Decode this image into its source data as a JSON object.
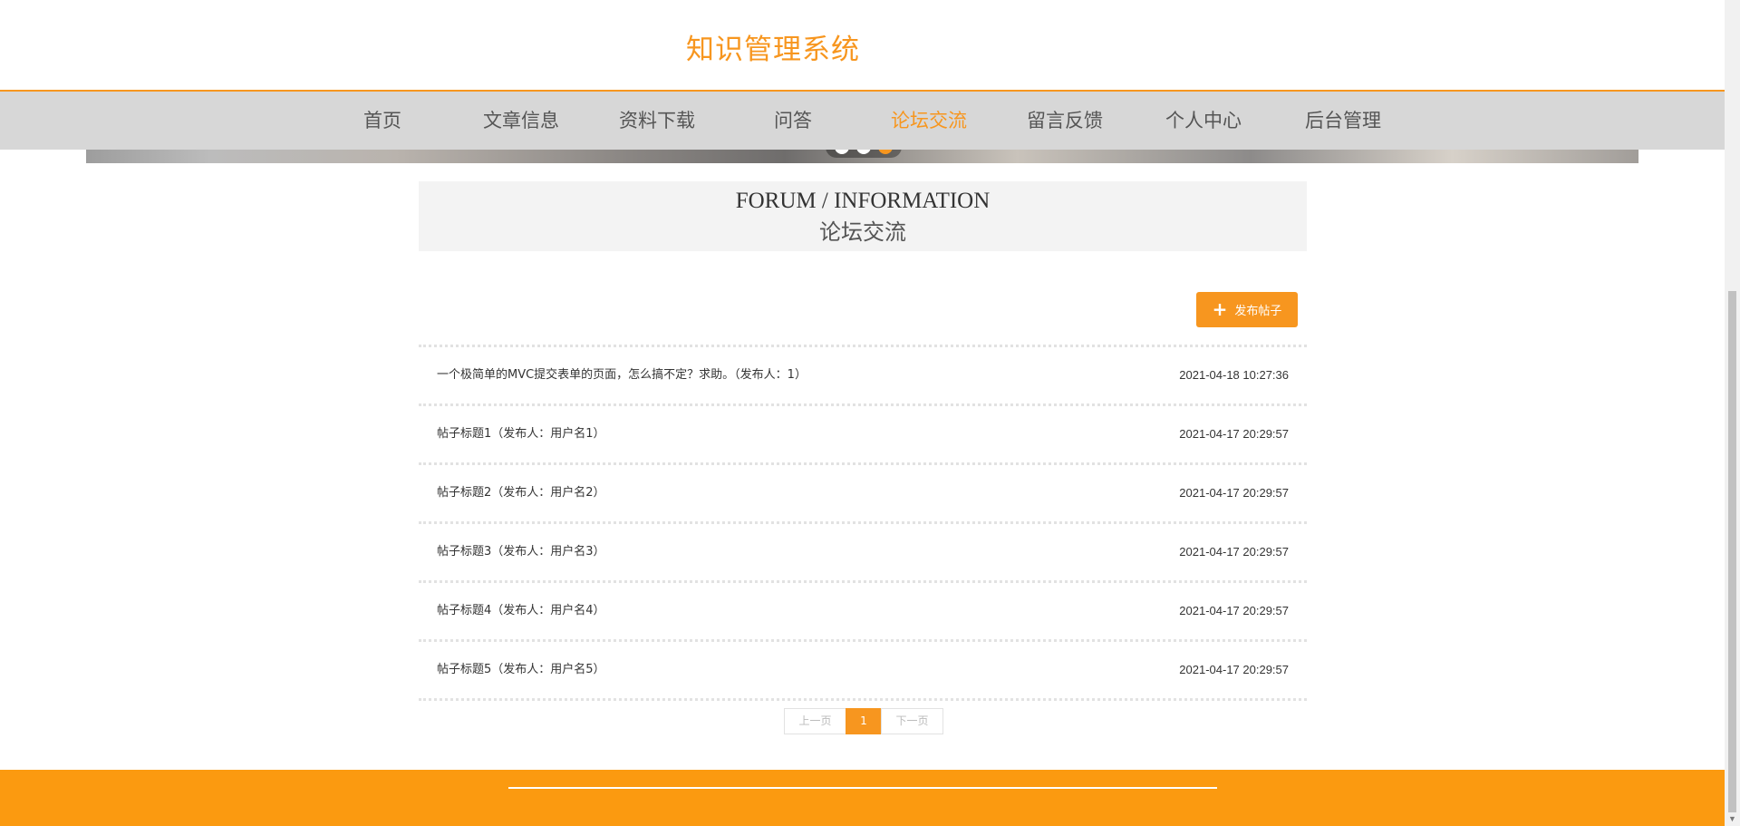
{
  "site": {
    "title": "知识管理系统"
  },
  "nav": {
    "items": [
      {
        "label": "首页"
      },
      {
        "label": "文章信息"
      },
      {
        "label": "资料下载"
      },
      {
        "label": "问答"
      },
      {
        "label": "论坛交流"
      },
      {
        "label": "留言反馈"
      },
      {
        "label": "个人中心"
      },
      {
        "label": "后台管理"
      }
    ],
    "active_index": 4
  },
  "banner": {
    "slide_count": 3,
    "active_slide": 3
  },
  "section": {
    "title_en": "FORUM / INFORMATION",
    "title_zh": "论坛交流"
  },
  "actions": {
    "post_button_label": "发布帖子",
    "post_button_icon": "plus-icon"
  },
  "topics": [
    {
      "title": "一个极简单的MVC提交表单的页面，怎么搞不定？求助。（发布人：1）",
      "time": "2021-04-18 10:27:36"
    },
    {
      "title": "帖子标题1（发布人：用户名1）",
      "time": "2021-04-17 20:29:57"
    },
    {
      "title": "帖子标题2（发布人：用户名2）",
      "time": "2021-04-17 20:29:57"
    },
    {
      "title": "帖子标题3（发布人：用户名3）",
      "time": "2021-04-17 20:29:57"
    },
    {
      "title": "帖子标题4（发布人：用户名4）",
      "time": "2021-04-17 20:29:57"
    },
    {
      "title": "帖子标题5（发布人：用户名5）",
      "time": "2021-04-17 20:29:57"
    }
  ],
  "pagination": {
    "prev_label": "上一页",
    "current_page": "1",
    "next_label": "下一页"
  },
  "colors": {
    "accent": "#f7961f",
    "footer": "#fb9a10",
    "nav_background": "#d7d7d7",
    "header_panel": "#f3f3f3"
  }
}
